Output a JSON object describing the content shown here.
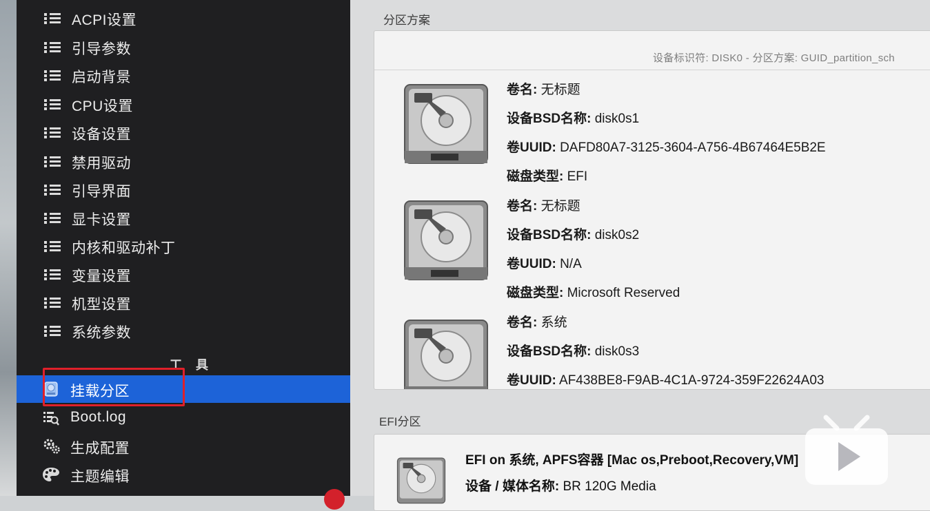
{
  "sidebar": {
    "items": [
      {
        "label": "ACPI设置"
      },
      {
        "label": "引导参数"
      },
      {
        "label": "启动背景"
      },
      {
        "label": "CPU设置"
      },
      {
        "label": "设备设置"
      },
      {
        "label": "禁用驱动"
      },
      {
        "label": "引导界面"
      },
      {
        "label": "显卡设置"
      },
      {
        "label": "内核和驱动补丁"
      },
      {
        "label": "变量设置"
      },
      {
        "label": "机型设置"
      },
      {
        "label": "系统参数"
      }
    ],
    "tools_title": "工具",
    "tools": [
      {
        "label": "挂载分区",
        "icon": "disk-icon",
        "active": true
      },
      {
        "label": "Boot.log",
        "icon": "log-icon"
      },
      {
        "label": "生成配置",
        "icon": "gear-icon"
      },
      {
        "label": "主题编辑",
        "icon": "palette-icon"
      }
    ]
  },
  "main": {
    "partition_scheme_title": "分区方案",
    "disk_header": "设备标识符: DISK0 - 分区方案: GUID_partition_sch",
    "partitions": [
      {
        "name_label": "卷名:",
        "name": "无标题",
        "bsd_label": "设备BSD名称:",
        "bsd": "disk0s1",
        "uuid_label": "卷UUID:",
        "uuid": "DAFD80A7-3125-3604-A756-4B67464E5B2E",
        "type_label": "磁盘类型:",
        "type": "EFI"
      },
      {
        "name_label": "卷名:",
        "name": "无标题",
        "bsd_label": "设备BSD名称:",
        "bsd": "disk0s2",
        "uuid_label": "卷UUID:",
        "uuid": "N/A",
        "type_label": "磁盘类型:",
        "type": "Microsoft Reserved"
      },
      {
        "name_label": "卷名:",
        "name": "系统",
        "bsd_label": "设备BSD名称:",
        "bsd": "disk0s3",
        "uuid_label": "卷UUID:",
        "uuid": "AF438BE8-F9AB-4C1A-9724-359F22624A03"
      }
    ],
    "efi_title": "EFI分区",
    "efi": {
      "title": "EFI on 系统, APFS容器 [Mac os,Preboot,Recovery,VM]",
      "media_label": "设备 / 媒体名称:",
      "media": "BR 120G Media"
    }
  },
  "colors": {
    "sidebar_bg": "#1f1f21",
    "active_bg": "#1d63d8",
    "highlight_box": "#e0202a"
  }
}
